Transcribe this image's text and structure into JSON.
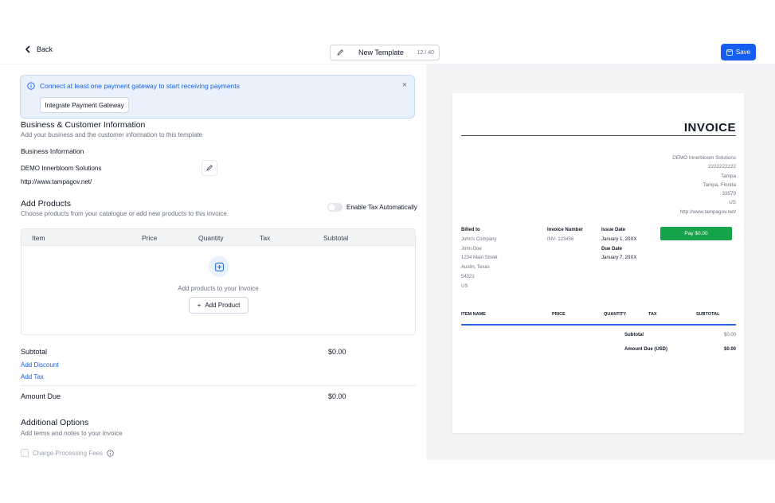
{
  "header": {
    "back_label": "Back",
    "template_name": "New Template",
    "char_count": "12 / 40",
    "save_label": "Save"
  },
  "banner": {
    "message": "Connect at least one payment gateway to start receiving payments",
    "button_label": "Integrate Payment Gateway",
    "close_glyph": "×"
  },
  "business_section": {
    "title": "Business & Customer Information",
    "subtitle": "Add your business and the customer information to this template",
    "info_heading": "Business Information",
    "business_name": "DEMO Innerbloom Solutions",
    "website": "http://www.tampagov.net/"
  },
  "products_section": {
    "title": "Add Products",
    "subtitle": "Choose products from your catalogue or add new products to this invoice",
    "tax_toggle_label": "Enable Tax Automatically",
    "columns": [
      "Item",
      "Price",
      "Quantity",
      "Tax",
      "Subtotal"
    ],
    "empty_text": "Add products to your Invoice",
    "add_button_label": "Add Product",
    "add_button_glyph": "+"
  },
  "summary": {
    "subtotal_label": "Subtotal",
    "subtotal_value": "$0.00",
    "add_discount": "Add Discount",
    "add_tax": "Add Tax",
    "amount_due_label": "Amount Due",
    "amount_due_value": "$0.00"
  },
  "additional": {
    "title": "Additional Options",
    "subtitle": "Add terms and notes to your invoice",
    "processing_fees_label": "Charge Processing Fees"
  },
  "preview": {
    "title": "INVOICE",
    "business_lines": [
      "DEMO Innerbloom Solutions",
      "2222222222",
      "Tampa",
      "Tampa, Florida",
      "33579",
      "US",
      "http://www.tampagov.net/"
    ],
    "billed_to_heading": "Billed to",
    "billed_to_lines": [
      "John's Company",
      "John Doe",
      "1234 Main Street",
      "Austin, Texas",
      "54321",
      "US"
    ],
    "invoice_number_heading": "Invoice Number",
    "invoice_number": "INV- 123456",
    "issue_date_heading": "Issue Date",
    "issue_date": "January 1, 20XX",
    "due_date_heading": "Due Date",
    "due_date": "January 7, 20XX",
    "pay_button": "Pay $0.00",
    "table_columns": [
      "ITEM NAME",
      "PRICE",
      "QUANTITY",
      "TAX",
      "SUBTOTAL"
    ],
    "subtotal_label": "Subtotal",
    "subtotal_value": "$0.00",
    "amount_due_label": "Amount Due (USD)",
    "amount_due_value": "$0.00"
  },
  "colors": {
    "accent": "#155eef",
    "banner_bg": "#e8f1fc",
    "pay_green": "#16a34a"
  }
}
